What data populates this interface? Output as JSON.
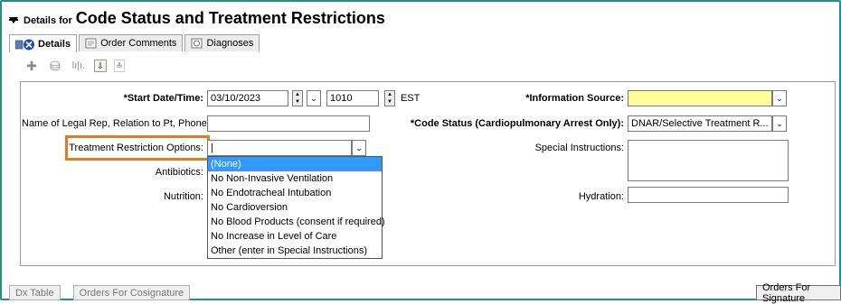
{
  "title": {
    "prefix": "Details for",
    "main": "Code Status and Treatment Restrictions"
  },
  "tabs": [
    {
      "label": "Details",
      "active": true
    },
    {
      "label": "Order Comments",
      "active": false
    },
    {
      "label": "Diagnoses",
      "active": false
    }
  ],
  "form": {
    "start_date_label": "*Start Date/Time:",
    "start_date_value": "03/10/2023",
    "start_time_value": "1010",
    "timezone": "EST",
    "legal_rep_label": "Name of Legal Rep, Relation to Pt, Phone:",
    "legal_rep_value": "",
    "treatment_label": "Treatment Restriction Options:",
    "treatment_value": "|",
    "antibiotics_label": "Antibiotics:",
    "nutrition_label": "Nutrition:",
    "info_source_label": "*Information Source:",
    "info_source_value": "",
    "code_status_label": "*Code Status (Cardiopulmonary Arrest Only):",
    "code_status_value": "DNAR/Selective Treatment R...",
    "special_instructions_label": "Special Instructions:",
    "special_instructions_value": "",
    "hydration_label": "Hydration:",
    "hydration_value": ""
  },
  "dropdown_options": [
    "(None)",
    "No Non-Invasive Ventilation",
    "No Endotracheal Intubation",
    "No Cardioversion",
    "No Blood Products (consent if required)",
    "No Increase in Level of Care",
    "Other (enter in Special Instructions)"
  ],
  "bottom": {
    "dx_table": "Dx Table",
    "orders_cosign": "Orders For Cosignature",
    "orders_signature": "Orders For Signature"
  },
  "colors": {
    "highlight": "#e07b1f",
    "selection": "#3399ff",
    "required_field": "#ffff99",
    "frame": "#1f8f8f"
  },
  "icons": [
    "collapse-arrow-icon",
    "details-tab-icon",
    "order-comments-tab-icon",
    "diagnoses-tab-icon",
    "add-icon",
    "copy-icon",
    "chart-icon",
    "flag-icon",
    "chevron-down-icon"
  ]
}
